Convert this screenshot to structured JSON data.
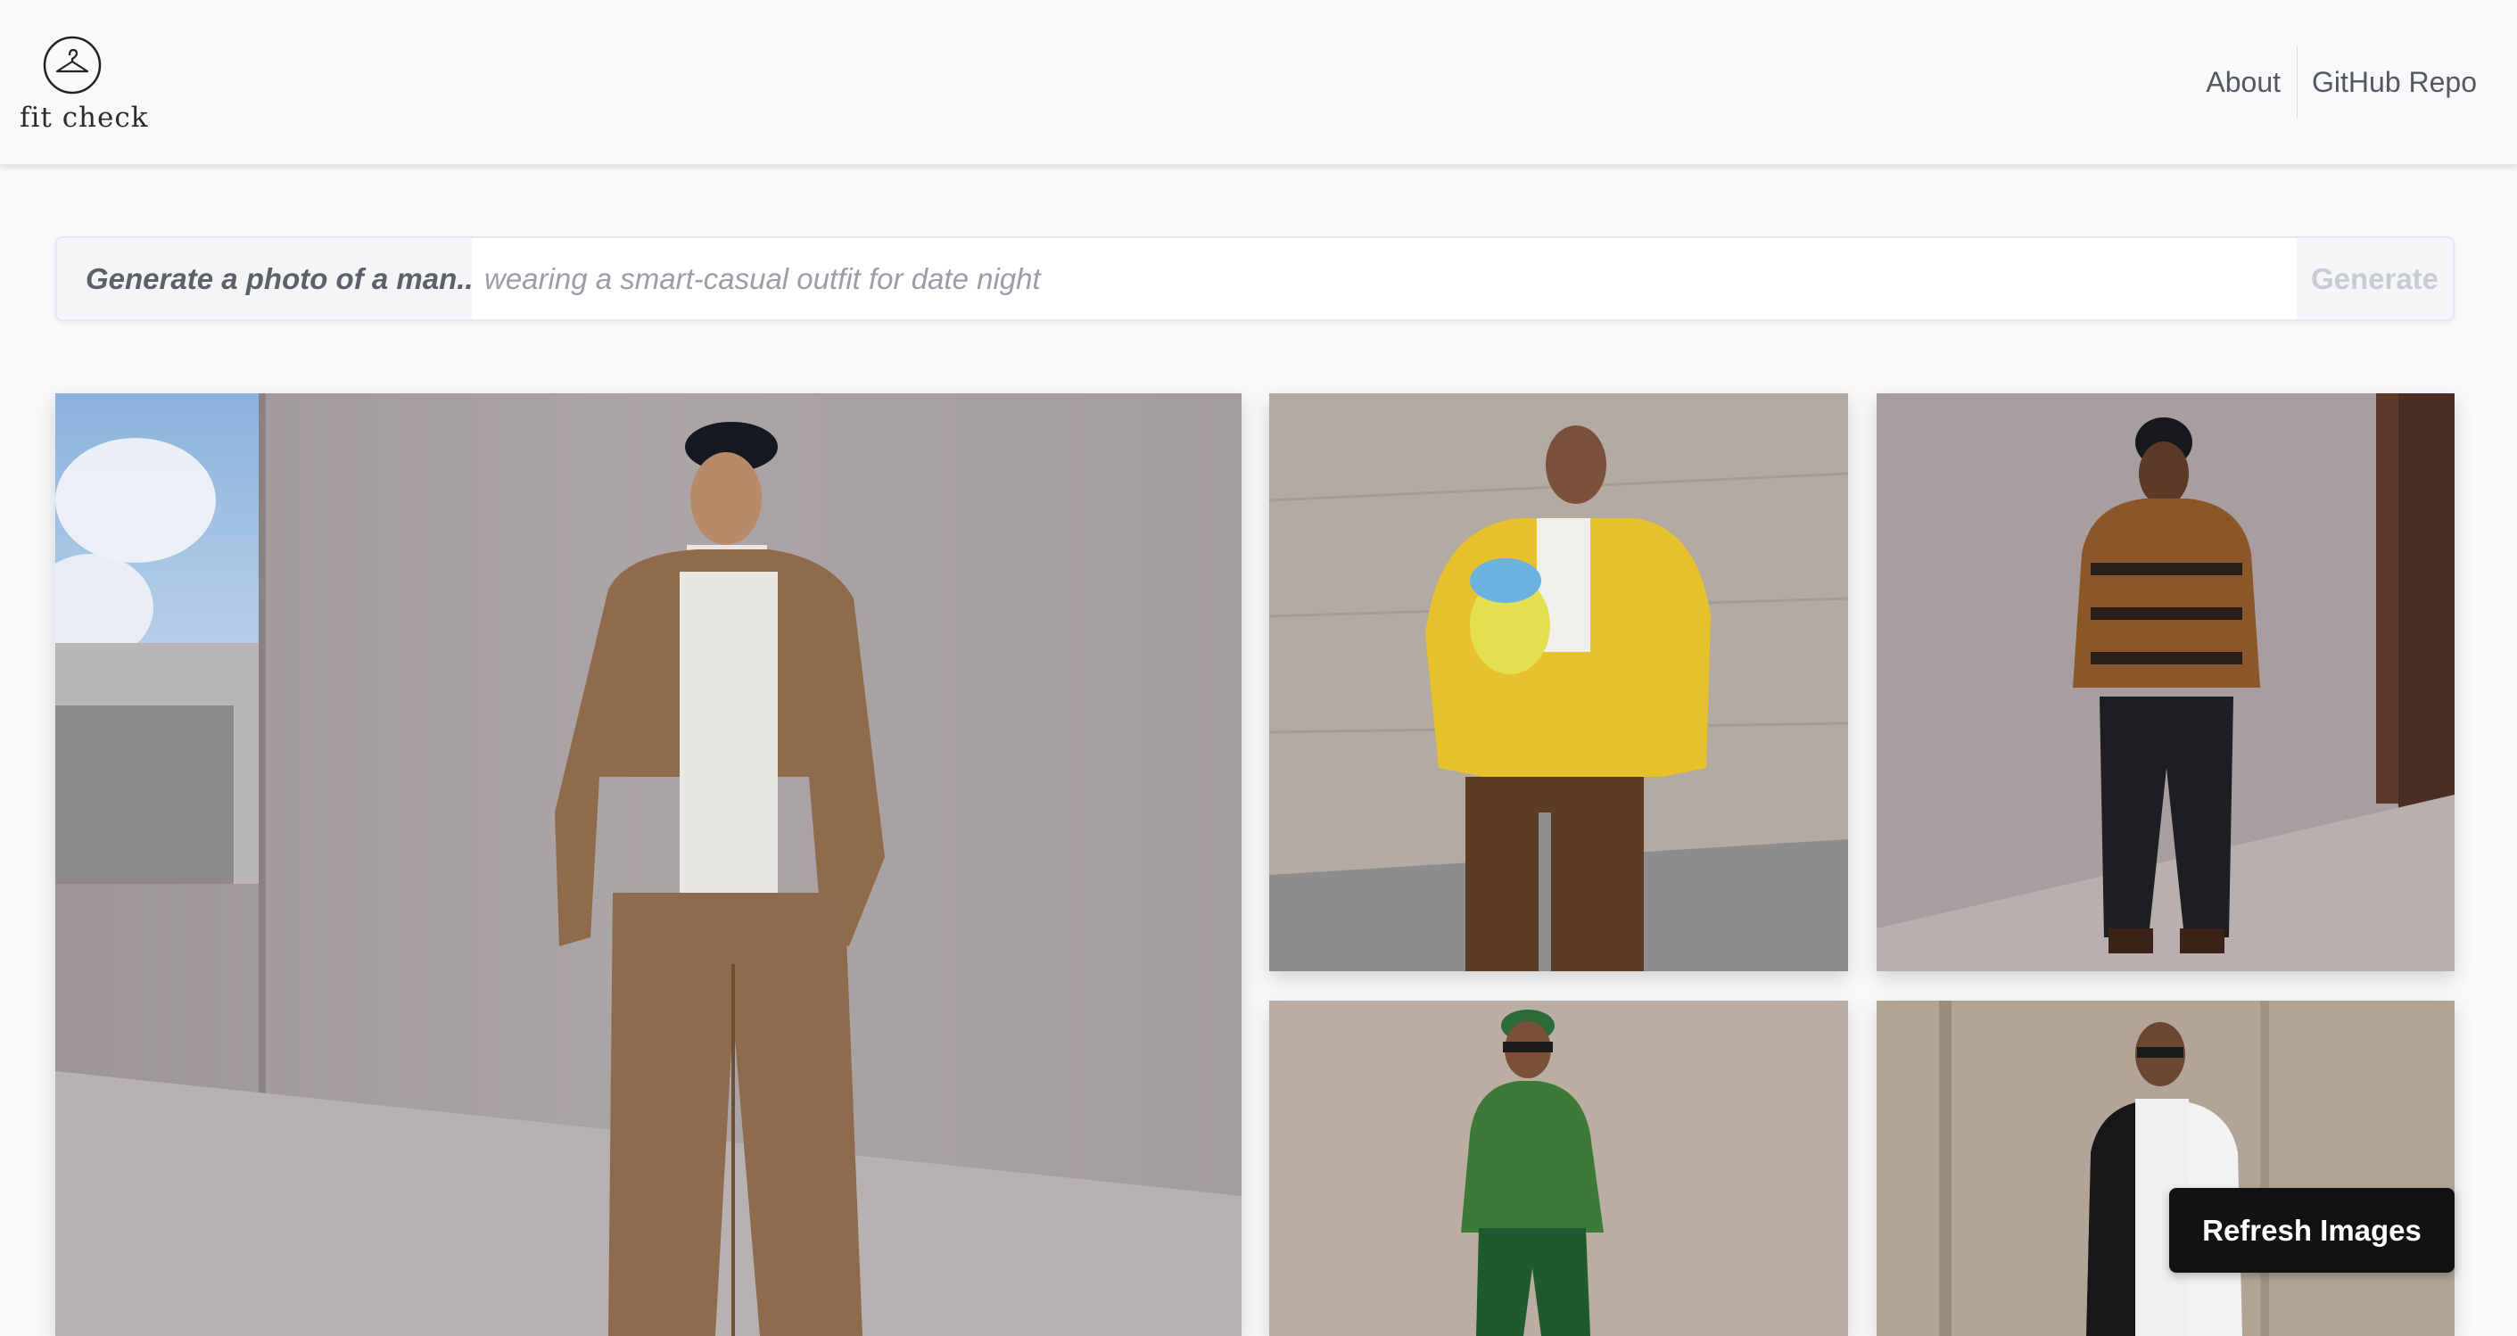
{
  "header": {
    "logo_text": "fit check",
    "logo_icon": "hanger-icon",
    "nav": [
      {
        "label": "About"
      },
      {
        "label": "GitHub Repo"
      }
    ]
  },
  "prompt": {
    "prefix": "Generate a photo of a man...",
    "placeholder": "wearing a smart-casual outfit for date night",
    "value": "",
    "generate_label": "Generate"
  },
  "gallery": {
    "images": [
      {
        "description": "man in brown overshirt and trousers with black cap"
      },
      {
        "description": "man in yellow cartoon graphic jacket"
      },
      {
        "description": "man in patterned brown sweater and beanie"
      },
      {
        "description": "man in green turtleneck and green cap"
      },
      {
        "description": "man in black and white varsity jacket"
      }
    ]
  },
  "refresh_label": "Refresh Images",
  "colors": {
    "background": "#f8f9fb",
    "button_dark": "#111214",
    "generate_disabled": "#c9ccd2"
  }
}
